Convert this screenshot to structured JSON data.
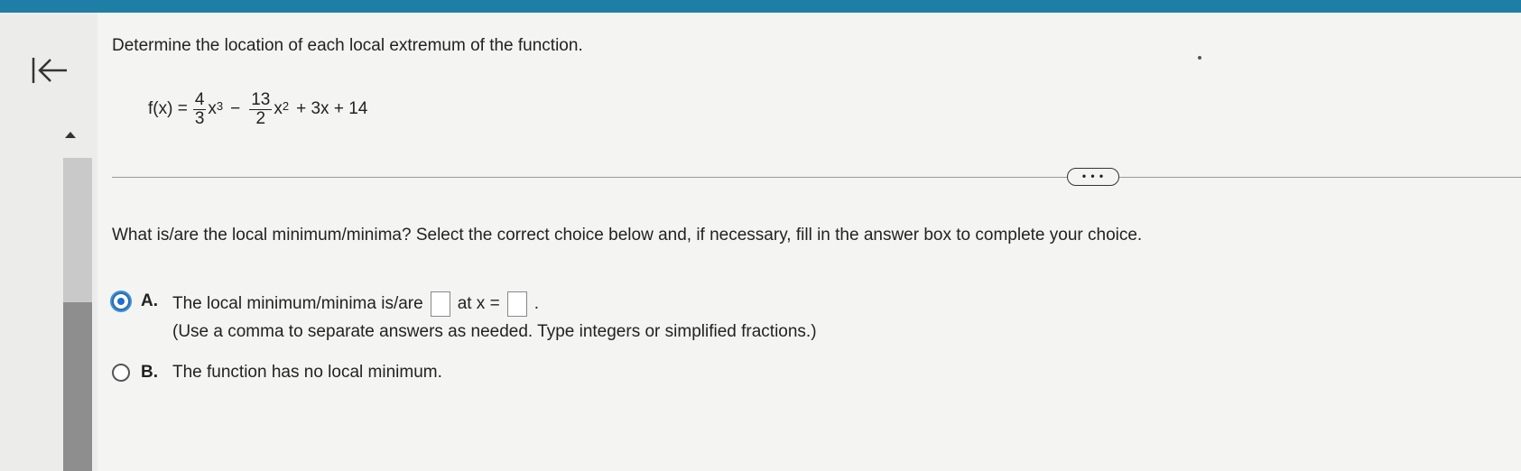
{
  "prompt": "Determine the location of each local extremum of the function.",
  "function": {
    "lhs": "f(x) =",
    "term1_num": "4",
    "term1_den": "3",
    "term1_var": "x",
    "term1_exp": "3",
    "minus": "−",
    "term2_num": "13",
    "term2_den": "2",
    "term2_var": "x",
    "term2_exp": "2",
    "rest": "+ 3x + 14"
  },
  "more_button": "• • •",
  "question": "What is/are the local minimum/minima? Select the correct choice below and, if necessary, fill in the answer box to complete your choice.",
  "choices": [
    {
      "letter": "A.",
      "text_before": "The local minimum/minima is/are",
      "text_middle": "at x =",
      "text_after": ".",
      "note": "(Use a comma to separate answers as needed. Type integers or simplified fractions.)",
      "selected": true
    },
    {
      "letter": "B.",
      "text": "The function has no local minimum.",
      "selected": false
    }
  ],
  "colors": {
    "top_bar": "#1f7ea5",
    "radio_selected": "#1c6ed2"
  },
  "icons": {
    "collapse": "arrow-left-to-bar-icon",
    "scroll_up": "triangle-up-icon"
  }
}
